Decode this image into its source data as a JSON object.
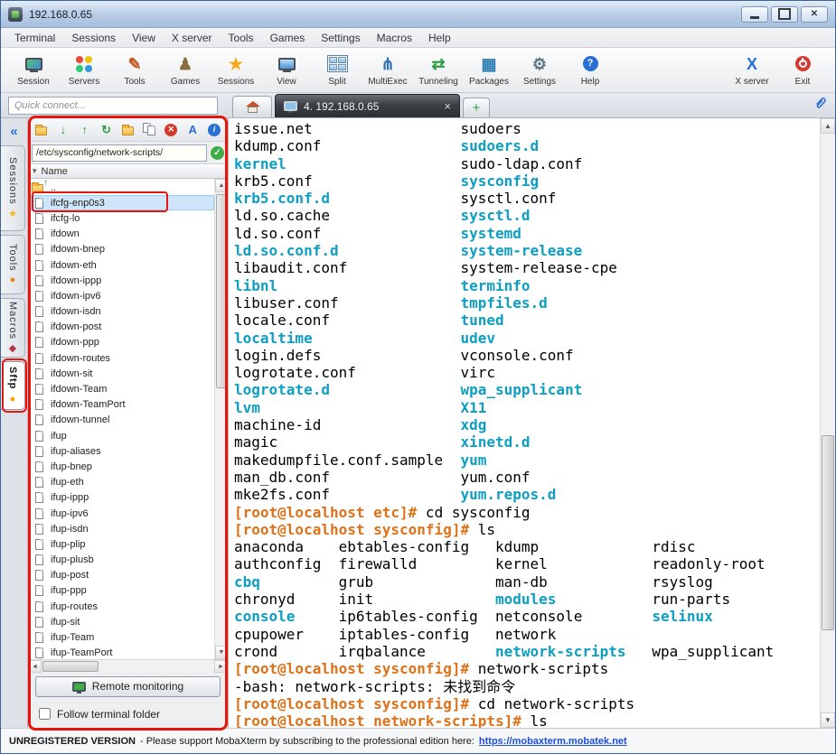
{
  "colors": {
    "annotation_red": "#e8150d",
    "terminal_text": "#000000",
    "terminal_directory": "#0d9ec2",
    "terminal_prompt": "#de7117",
    "link_blue": "#1f4fd8",
    "selection_blue": "#cfe6fa"
  },
  "titlebar": {
    "title": "192.168.0.65"
  },
  "menubar": {
    "items": [
      "Terminal",
      "Sessions",
      "View",
      "X server",
      "Tools",
      "Games",
      "Settings",
      "Macros",
      "Help"
    ]
  },
  "toolbar": {
    "items": [
      {
        "label": "Session",
        "icon": "session-icon"
      },
      {
        "label": "Servers",
        "icon": "servers-icon"
      },
      {
        "label": "Tools",
        "icon": "tools-icon"
      },
      {
        "label": "Games",
        "icon": "games-icon"
      },
      {
        "label": "Sessions",
        "icon": "sessions-icon"
      },
      {
        "label": "View",
        "icon": "view-icon"
      },
      {
        "label": "Split",
        "icon": "split-icon"
      },
      {
        "label": "MultiExec",
        "icon": "multiexec-icon"
      },
      {
        "label": "Tunneling",
        "icon": "tunneling-icon"
      },
      {
        "label": "Packages",
        "icon": "packages-icon"
      },
      {
        "label": "Settings",
        "icon": "settings-icon"
      },
      {
        "label": "Help",
        "icon": "help-icon"
      },
      {
        "label": "X server",
        "icon": "xserver-icon",
        "align": "right"
      },
      {
        "label": "Exit",
        "icon": "exit-icon"
      }
    ]
  },
  "quick_connect": {
    "placeholder": "Quick connect..."
  },
  "tabbar": {
    "active_tab": "4. 192.168.0.65"
  },
  "side_tabs": {
    "items": [
      {
        "label": "Sessions",
        "icon": "star-icon"
      },
      {
        "label": "Tools",
        "icon": "dot-orange-icon"
      },
      {
        "label": "Macros",
        "icon": "diamond-icon"
      },
      {
        "label": "Sftp",
        "icon": "dot-amber-icon",
        "active": true
      }
    ]
  },
  "sftp": {
    "toolbar_icons": [
      "new-folder-icon",
      "download-icon",
      "upload-icon",
      "refresh-icon",
      "open-folder-icon",
      "copy-icon",
      "delete-icon",
      "font-icon",
      "info-icon"
    ],
    "path": "/etc/sysconfig/network-scripts/",
    "header": "Name",
    "selected_file": "ifcfg-enp0s3",
    "files": [
      "..",
      "ifcfg-enp0s3",
      "ifcfg-lo",
      "ifdown",
      "ifdown-bnep",
      "ifdown-eth",
      "ifdown-ippp",
      "ifdown-ipv6",
      "ifdown-isdn",
      "ifdown-post",
      "ifdown-ppp",
      "ifdown-routes",
      "ifdown-sit",
      "ifdown-Team",
      "ifdown-TeamPort",
      "ifdown-tunnel",
      "ifup",
      "ifup-aliases",
      "ifup-bnep",
      "ifup-eth",
      "ifup-ippp",
      "ifup-ipv6",
      "ifup-isdn",
      "ifup-plip",
      "ifup-plusb",
      "ifup-post",
      "ifup-ppp",
      "ifup-routes",
      "ifup-sit",
      "ifup-Team",
      "ifup-TeamPort"
    ],
    "remote_monitoring_label": "Remote monitoring",
    "follow_label": "Follow terminal folder"
  },
  "terminal": {
    "colors": {
      "t": "#000000",
      "d": "#0d9ec2",
      "p": "#de7117"
    },
    "lines": [
      [
        [
          "issue.net                 sudoers",
          "t"
        ]
      ],
      [
        [
          "kdump.conf                ",
          "t"
        ],
        [
          "sudoers.d",
          "d"
        ]
      ],
      [
        [
          "kernel",
          "d"
        ],
        [
          "                    sudo-ldap.conf",
          "t"
        ]
      ],
      [
        [
          "krb5.conf                 ",
          "t"
        ],
        [
          "sysconfig",
          "d"
        ]
      ],
      [
        [
          "krb5.conf.d",
          "d"
        ],
        [
          "               sysctl.conf",
          "t"
        ]
      ],
      [
        [
          "ld.so.cache               ",
          "t"
        ],
        [
          "sysctl.d",
          "d"
        ]
      ],
      [
        [
          "ld.so.conf                ",
          "t"
        ],
        [
          "systemd",
          "d"
        ]
      ],
      [
        [
          "ld.so.conf.d",
          "d"
        ],
        [
          "              ",
          "t"
        ],
        [
          "system-release",
          "d"
        ]
      ],
      [
        [
          "libaudit.conf             system-release-cpe",
          "t"
        ]
      ],
      [
        [
          "libnl",
          "d"
        ],
        [
          "                     ",
          "t"
        ],
        [
          "terminfo",
          "d"
        ]
      ],
      [
        [
          "libuser.conf              ",
          "t"
        ],
        [
          "tmpfiles.d",
          "d"
        ]
      ],
      [
        [
          "locale.conf               ",
          "t"
        ],
        [
          "tuned",
          "d"
        ]
      ],
      [
        [
          "localtime",
          "d"
        ],
        [
          "                 ",
          "t"
        ],
        [
          "udev",
          "d"
        ]
      ],
      [
        [
          "login.defs                vconsole.conf",
          "t"
        ]
      ],
      [
        [
          "logrotate.conf            virc",
          "t"
        ]
      ],
      [
        [
          "logrotate.d",
          "d"
        ],
        [
          "               ",
          "t"
        ],
        [
          "wpa_supplicant",
          "d"
        ]
      ],
      [
        [
          "lvm",
          "d"
        ],
        [
          "                       ",
          "t"
        ],
        [
          "X11",
          "d"
        ]
      ],
      [
        [
          "machine-id                ",
          "t"
        ],
        [
          "xdg",
          "d"
        ]
      ],
      [
        [
          "magic                     ",
          "t"
        ],
        [
          "xinetd.d",
          "d"
        ]
      ],
      [
        [
          "makedumpfile.conf.sample  ",
          "t"
        ],
        [
          "yum",
          "d"
        ]
      ],
      [
        [
          "man_db.conf               yum.conf",
          "t"
        ]
      ],
      [
        [
          "mke2fs.conf               ",
          "t"
        ],
        [
          "yum.repos.d",
          "d"
        ]
      ],
      [
        [
          "[root@localhost etc]#",
          "p"
        ],
        [
          " cd sysconfig",
          "t"
        ]
      ],
      [
        [
          "[root@localhost sysconfig]#",
          "p"
        ],
        [
          " ls",
          "t"
        ]
      ],
      [
        [
          "anaconda    ebtables-config   kdump             rdisc",
          "t"
        ]
      ],
      [
        [
          "authconfig  firewalld         kernel            readonly-root",
          "t"
        ]
      ],
      [
        [
          "cbq",
          "d"
        ],
        [
          "         grub              man-db            rsyslog",
          "t"
        ]
      ],
      [
        [
          "chronyd     init              ",
          "t"
        ],
        [
          "modules",
          "d"
        ],
        [
          "           run-parts",
          "t"
        ]
      ],
      [
        [
          "console",
          "d"
        ],
        [
          "     ip6tables-config  netconsole        ",
          "t"
        ],
        [
          "selinux",
          "d"
        ]
      ],
      [
        [
          "cpupower    iptables-config   network",
          "t"
        ]
      ],
      [
        [
          "crond       irqbalance        ",
          "t"
        ],
        [
          "network-scripts",
          "d"
        ],
        [
          "   wpa_supplicant",
          "t"
        ]
      ],
      [
        [
          "[root@localhost sysconfig]#",
          "p"
        ],
        [
          " network-scripts",
          "t"
        ]
      ],
      [
        [
          "-bash: network-scripts: 未找到命令",
          "t"
        ]
      ],
      [
        [
          "[root@localhost sysconfig]#",
          "p"
        ],
        [
          " cd network-scripts",
          "t"
        ]
      ],
      [
        [
          "[root@localhost network-scripts]#",
          "p"
        ],
        [
          " ls",
          "t"
        ]
      ]
    ]
  },
  "statusbar": {
    "version": "UNREGISTERED VERSION",
    "message": "-  Please support MobaXterm by subscribing to the professional edition here:",
    "link": "https://mobaxterm.mobatek.net"
  }
}
